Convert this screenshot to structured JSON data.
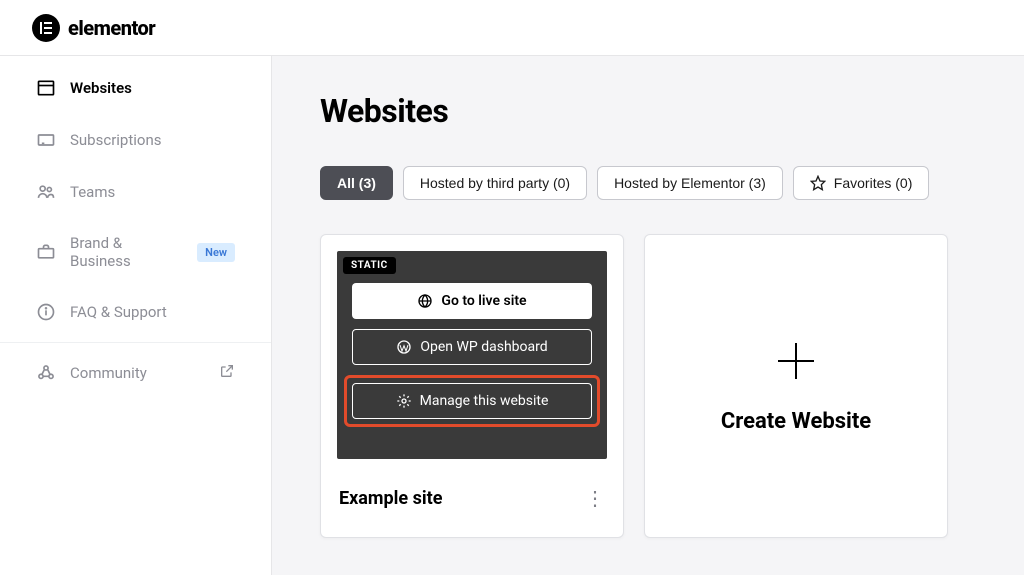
{
  "brand": {
    "name": "elementor",
    "mark": "E"
  },
  "sidebar": {
    "items": [
      {
        "label": "Websites"
      },
      {
        "label": "Subscriptions"
      },
      {
        "label": "Teams"
      },
      {
        "label": "Brand & Business",
        "badge": "New"
      },
      {
        "label": "FAQ & Support"
      },
      {
        "label": "Community"
      }
    ]
  },
  "page": {
    "title": "Websites"
  },
  "filters": {
    "all": "All (3)",
    "third_party": "Hosted by third party (0)",
    "elementor": "Hosted by Elementor (3)",
    "favorites": "Favorites (0)"
  },
  "site_card": {
    "static_tag": "STATIC",
    "go_live": "Go to live site",
    "open_wp": "Open WP dashboard",
    "manage": "Manage this website",
    "title": "Example site"
  },
  "create_card": {
    "label": "Create Website"
  }
}
